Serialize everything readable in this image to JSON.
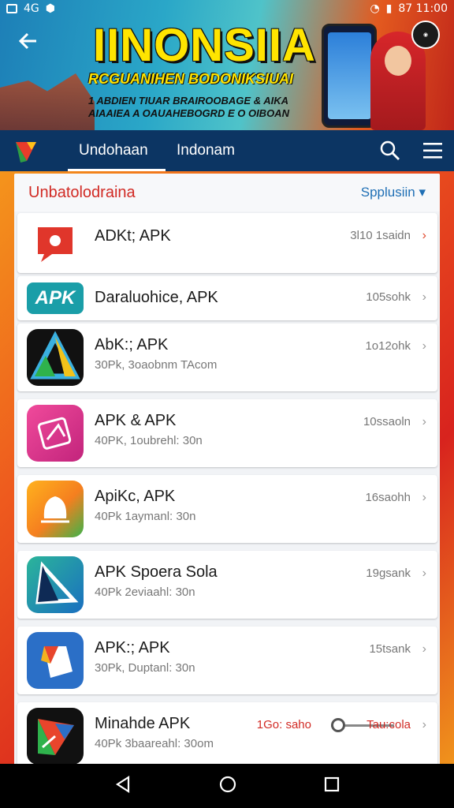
{
  "status": {
    "left": "4G",
    "time": "87 11:00"
  },
  "banner": {
    "title": "IINONSIIA",
    "subtitle": "RCGUANIHEN BODONIKSIUAI",
    "line1": "1 ABDIEN TIUAR BRAIROOBAGE & AIKA",
    "line2": "AIAAIEA A OAUAHEBOGRD E O OIBOAN"
  },
  "nav": {
    "tabs": [
      "Undohaan",
      "Indonam"
    ]
  },
  "panel": {
    "title": "Unbatolodraina",
    "sort_label": "Spplusiin ▾"
  },
  "apps": [
    {
      "name": "ADKt; APK",
      "sub": "",
      "size": "3l10 1saidn",
      "icon": "red-chat-icon",
      "color": "#e0362b"
    },
    {
      "name": "Daraluohice, APK",
      "sub": "",
      "size": "105sohk",
      "icon": "apk-badge-icon",
      "color": "#1a9ea8"
    },
    {
      "name": "AbK:; APK",
      "sub": "30Pk, 3oaobnm TAcom",
      "size": "1o12ohk",
      "icon": "triangle-play-icon",
      "color": "#111111"
    },
    {
      "name": "APK & APK",
      "sub": "40PK, 1oubrehl: 30n",
      "size": "10ssaoln",
      "icon": "pink-tag-icon",
      "color": "#e2388f"
    },
    {
      "name": "ApiKc, APK",
      "sub": "40Pk 1aymanl: 30n",
      "size": "16saohh",
      "icon": "bell-leaf-icon",
      "color": "#f4a021"
    },
    {
      "name": "APK Spoera Sola",
      "sub": "40Pk 2eviaahl: 30n",
      "size": "19gsank",
      "icon": "blue-triangle-icon",
      "color": "#1aa3a0"
    },
    {
      "name": "APK:; APK",
      "sub": "30Pk, Duptanl: 30n",
      "size": "15tsank",
      "icon": "folded-tag-icon",
      "color": "#2b6fc7"
    },
    {
      "name": "Minahde APK",
      "sub": "40Pk 3baareahl: 30om",
      "size_left": "1Go: saho",
      "size": "Tau:cola",
      "icon": "colorful-arrow-icon",
      "color": "#111111"
    }
  ]
}
